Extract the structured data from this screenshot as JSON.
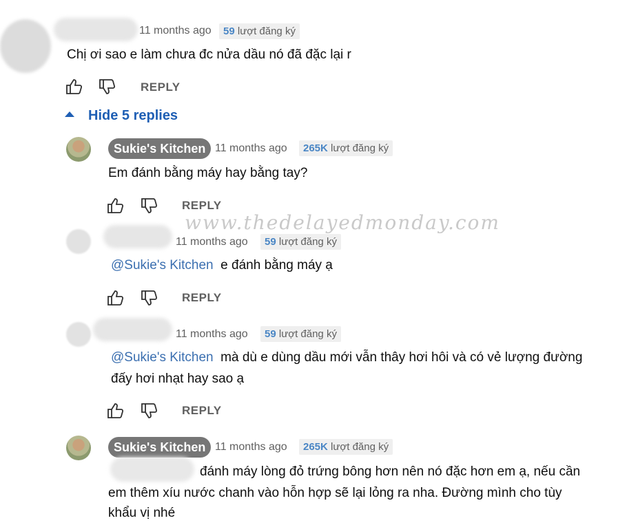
{
  "top_comment": {
    "time": "11 months ago",
    "subs_count": "59",
    "subs_label": "lượt đăng ký",
    "text": "Chị ơi sao e làm chưa đc nửa dầu nó đã đặc lại r",
    "reply_label": "REPLY"
  },
  "replies_toggle": {
    "label": "Hide 5 replies"
  },
  "replies": [
    {
      "author": "Sukie's Kitchen",
      "time": "11 months ago",
      "subs_count": "265K",
      "subs_label": "lượt đăng ký",
      "text": "Em đánh bằng máy hay bằng tay?",
      "reply_label": "REPLY"
    },
    {
      "time": "11 months ago",
      "subs_count": "59",
      "subs_label": "lượt đăng ký",
      "mention": "@Sukie's Kitchen",
      "text": "e đánh bằng máy ạ",
      "reply_label": "REPLY"
    },
    {
      "time": "11 months ago",
      "subs_count": "59",
      "subs_label": "lượt đăng ký",
      "mention": "@Sukie's Kitchen",
      "text_line1": "mà dù e dùng dầu mới vẫn thây hơi hôi và có vẻ lượng đường",
      "text_line2": "đấy hơi nhạt hay sao ạ",
      "reply_label": "REPLY"
    },
    {
      "author": "Sukie's Kitchen",
      "time": "11 months ago",
      "subs_count": "265K",
      "subs_label": "lượt đăng ký",
      "text_line1": "đánh máy lòng đỏ trứng bông hơn nên nó đặc hơn em ạ, nếu cần",
      "text_line2": "em thêm xíu nước chanh vào hỗn hợp sẽ lại lỏng ra nha. Đường mình cho tùy",
      "text_line3": "khẩu vị nhé"
    }
  ],
  "watermark": "www.thedelayedmonday.com",
  "icons": {
    "like": "thumbs-up-icon",
    "dislike": "thumbs-down-icon",
    "collapse": "caret-up-icon"
  },
  "colors": {
    "link": "#1f5fb4",
    "mention": "#3b6fb0",
    "chip_bg": "#767676",
    "subs_accent": "#4a86c5"
  }
}
